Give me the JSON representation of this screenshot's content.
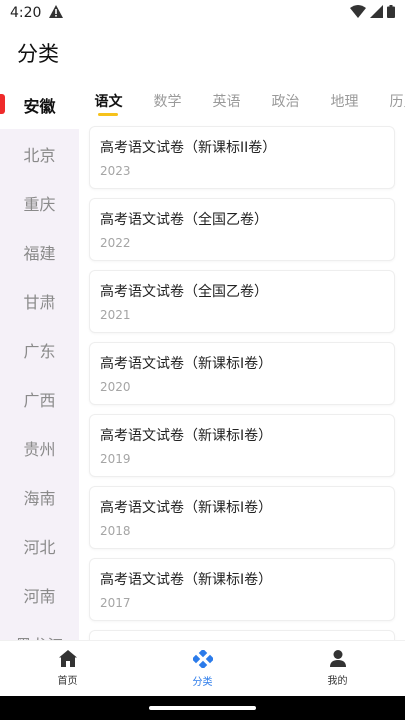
{
  "status": {
    "time": "4:20"
  },
  "app": {
    "title": "分类"
  },
  "sidebar": {
    "items": [
      {
        "label": "安徽",
        "active": true
      },
      {
        "label": "北京"
      },
      {
        "label": "重庆"
      },
      {
        "label": "福建"
      },
      {
        "label": "甘肃"
      },
      {
        "label": "广东"
      },
      {
        "label": "广西"
      },
      {
        "label": "贵州"
      },
      {
        "label": "海南"
      },
      {
        "label": "河北"
      },
      {
        "label": "河南"
      },
      {
        "label": "黑龙江"
      }
    ]
  },
  "tabs": [
    {
      "label": "语文",
      "active": true
    },
    {
      "label": "数学"
    },
    {
      "label": "英语"
    },
    {
      "label": "政治"
    },
    {
      "label": "地理"
    },
    {
      "label": "历史"
    }
  ],
  "papers": [
    {
      "title": "高考语文试卷（新课标II卷）",
      "year": "2023"
    },
    {
      "title": "高考语文试卷（全国乙卷）",
      "year": "2022"
    },
    {
      "title": "高考语文试卷（全国乙卷）",
      "year": "2021"
    },
    {
      "title": "高考语文试卷（新课标I卷）",
      "year": "2020"
    },
    {
      "title": "高考语文试卷（新课标I卷）",
      "year": "2019"
    },
    {
      "title": "高考语文试卷（新课标I卷）",
      "year": "2018"
    },
    {
      "title": "高考语文试卷（新课标I卷）",
      "year": "2017"
    },
    {
      "title": "",
      "year": ""
    }
  ],
  "bottom_nav": [
    {
      "label": "首页",
      "icon": "home-icon"
    },
    {
      "label": "分类",
      "icon": "category-icon",
      "active": true
    },
    {
      "label": "我的",
      "icon": "profile-icon"
    }
  ],
  "colors": {
    "accent": "#2b7bea",
    "tab_underline": "#f6c21b",
    "sidebar_marker": "#ef2b2b",
    "sidebar_bg": "#f5f1f8"
  }
}
